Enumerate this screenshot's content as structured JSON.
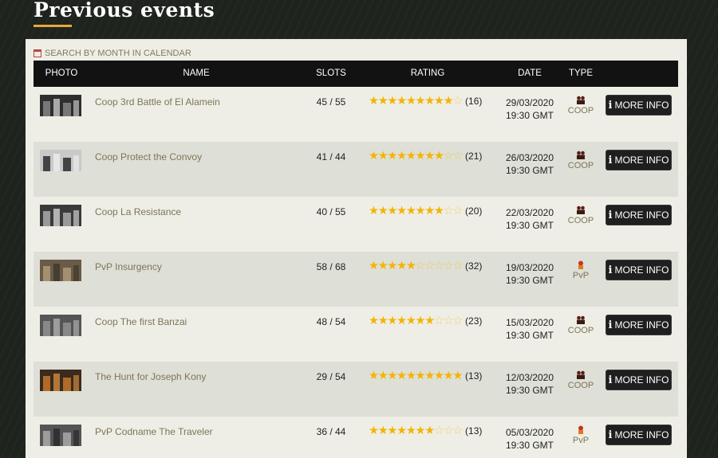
{
  "page": {
    "title": "Previous events",
    "calendar_link": "SEARCH BY MONTH IN CALENDAR",
    "calendar_icon": "calendar-icon"
  },
  "colors": {
    "accent": "#e8a838",
    "star": "#f4b400",
    "link": "#7e7558",
    "header_bg": "#121212",
    "panel_bg": "#eeeee6",
    "row_alt_bg": "#dedfd6"
  },
  "table": {
    "headers": {
      "photo": "PHOTO",
      "name": "NAME",
      "slots": "SLOTS",
      "rating": "RATING",
      "date": "DATE",
      "type": "TYPE"
    },
    "rows": [
      {
        "name": "Coop 3rd Battle of El Alamein",
        "slots": "45 / 55",
        "rating": 4.5,
        "count": "(16)",
        "date": "29/03/2020",
        "time": "19:30 GMT",
        "type": "COOP",
        "type_icon": "coop-icon",
        "button": "MORE INFO"
      },
      {
        "name": "Coop Protect the Convoy",
        "slots": "41 / 44",
        "rating": 4.0,
        "count": "(21)",
        "date": "26/03/2020",
        "time": "19:30 GMT",
        "type": "COOP",
        "type_icon": "coop-icon",
        "button": "MORE INFO"
      },
      {
        "name": "Coop La Resistance",
        "slots": "40 / 55",
        "rating": 4.0,
        "count": "(20)",
        "date": "22/03/2020",
        "time": "19:30 GMT",
        "type": "COOP",
        "type_icon": "coop-icon",
        "button": "MORE INFO"
      },
      {
        "name": "PvP Insurgency",
        "slots": "58 / 68",
        "rating": 2.5,
        "count": "(32)",
        "date": "19/03/2020",
        "time": "19:30 GMT",
        "type": "PvP",
        "type_icon": "pvp-icon",
        "button": "MORE INFO"
      },
      {
        "name": "Coop The first Banzai",
        "slots": "48 / 54",
        "rating": 3.5,
        "count": "(23)",
        "date": "15/03/2020",
        "time": "19:30 GMT",
        "type": "COOP",
        "type_icon": "coop-icon",
        "button": "MORE INFO"
      },
      {
        "name": "The Hunt for Joseph Kony",
        "slots": "29 / 54",
        "rating": 5.0,
        "count": "(13)",
        "date": "12/03/2020",
        "time": "19:30 GMT",
        "type": "COOP",
        "type_icon": "coop-icon",
        "button": "MORE INFO"
      },
      {
        "name": "PvP Codname The Traveler",
        "slots": "36 / 44",
        "rating": 3.5,
        "count": "(13)",
        "date": "05/03/2020",
        "time": "19:30 GMT",
        "type": "PvP",
        "type_icon": "pvp-icon",
        "button": "MORE INFO"
      }
    ]
  }
}
